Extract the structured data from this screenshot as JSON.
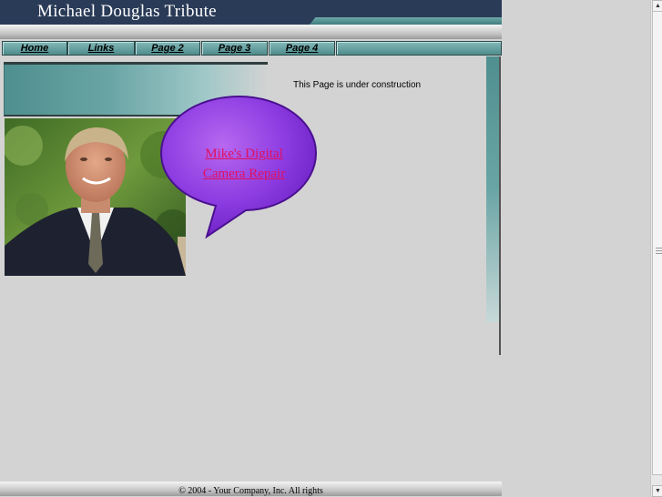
{
  "header": {
    "title": "Michael Douglas Tribute"
  },
  "nav": {
    "items": [
      "Home",
      "Links",
      "Page 2",
      "Page 3",
      "Page 4"
    ]
  },
  "main": {
    "construction_text": "This Page is under construction",
    "bubble_line1": "Mike's Digital",
    "bubble_line2": "Camera Repair"
  },
  "footer": {
    "text": "© 2004 - Your Company, Inc. All rights"
  },
  "colors": {
    "header_bg": "#2a3b57",
    "nav_teal": "#5f9c9c",
    "bubble_purple": "#8a2be2",
    "link": "#e01060",
    "page_bg": "#d3d3d3"
  }
}
